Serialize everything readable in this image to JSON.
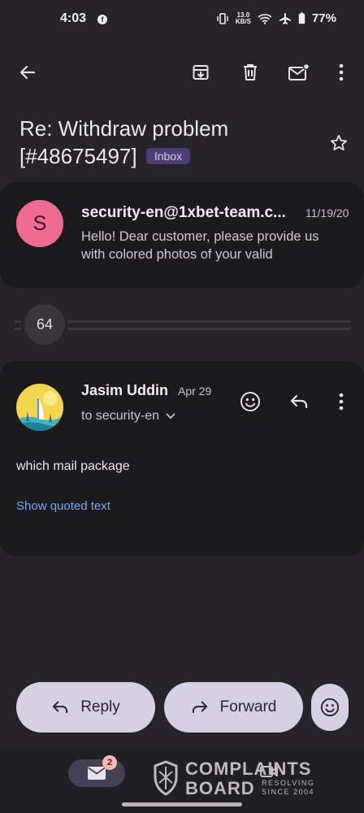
{
  "status_bar": {
    "time": "4:03",
    "speed_value": "13.0",
    "speed_unit": "KB/S",
    "battery": "77%"
  },
  "top_bar": {
    "icons": [
      "back-arrow-icon",
      "archive-icon",
      "delete-icon",
      "mark-unread-icon",
      "more-vert-icon"
    ]
  },
  "subject": {
    "text": "Re: Withdraw problem [#48675497]",
    "label_chip": "Inbox"
  },
  "thread": {
    "first_message": {
      "avatar_letter": "S",
      "avatar_color": "#ee6b91",
      "sender": "security-en@1xbet-team.c...",
      "date": "11/19/20",
      "snippet": "Hello! Dear customer, please provide us with colored photos of your valid"
    },
    "collapsed_count": "64",
    "latest_message": {
      "sender": "Jasim Uddin",
      "date": "Apr 29",
      "to": "to security-en",
      "body": "which mail package",
      "show_quoted": "Show quoted text"
    }
  },
  "actions": {
    "reply": "Reply",
    "forward": "Forward"
  },
  "nav": {
    "mail_badge": "2"
  },
  "watermark": {
    "line1": "COMPLAINTS",
    "line2": "BOARD",
    "tagline": "RESOLVING SINCE 2004"
  },
  "colors": {
    "background": "#262428",
    "card": "#1b1a1d",
    "chip": "#4b3f73",
    "link": "#7fa6e9",
    "pill_button": "#d5d0e3"
  }
}
